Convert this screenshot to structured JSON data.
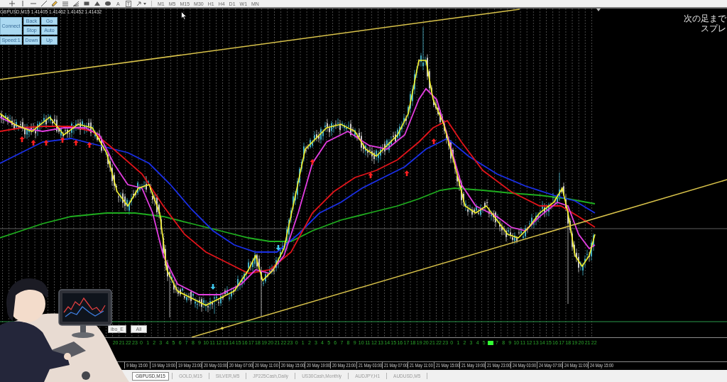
{
  "toolbar": {
    "glyph_tools": [
      {
        "label": "A",
        "kind": "plain"
      },
      {
        "label": "T",
        "kind": "boxed"
      }
    ],
    "timeframes": [
      "M1",
      "M5",
      "M15",
      "M30",
      "H1",
      "H4",
      "D1",
      "W1",
      "MN"
    ]
  },
  "chart": {
    "header": "GBPUSD,M15 1.41405 1.41462 1.41452 1.41432",
    "control_buttons": [
      {
        "label": "Connect",
        "kind": "tall"
      },
      {
        "label": "Back",
        "kind": "small"
      },
      {
        "label": "Go",
        "kind": "small"
      },
      {
        "label": "Stop",
        "kind": "small"
      },
      {
        "label": "Auto",
        "kind": "small"
      },
      {
        "label": "Speed:1",
        "kind": "small"
      },
      {
        "label": "Down",
        "kind": "small"
      },
      {
        "label": "Up",
        "kind": "small"
      }
    ],
    "info_lines": [
      "次の足まで",
      "スプレ"
    ],
    "object_buttons": [
      "ibo_E",
      "All"
    ]
  },
  "hour_labels": [
    {
      "kind": "hour",
      "text": "20"
    },
    {
      "kind": "hour",
      "text": "21"
    },
    {
      "kind": "hour",
      "text": "22"
    },
    {
      "kind": "hour",
      "text": "23"
    },
    {
      "kind": "hour",
      "text": "0"
    },
    {
      "kind": "hour",
      "text": "1"
    },
    {
      "kind": "hour",
      "text": "2"
    },
    {
      "kind": "hour",
      "text": "3"
    },
    {
      "kind": "hour",
      "text": "4"
    },
    {
      "kind": "hour",
      "text": "5"
    },
    {
      "kind": "hour",
      "text": "6"
    },
    {
      "kind": "hour",
      "text": "7"
    },
    {
      "kind": "hour",
      "text": "8"
    },
    {
      "kind": "hour",
      "text": "9"
    },
    {
      "kind": "hour",
      "text": "10"
    },
    {
      "kind": "hour",
      "text": "11"
    },
    {
      "kind": "hour",
      "text": "12"
    },
    {
      "kind": "hour",
      "text": "13"
    },
    {
      "kind": "hour",
      "text": "14"
    },
    {
      "kind": "hour",
      "text": "15"
    },
    {
      "kind": "hour",
      "text": "16"
    },
    {
      "kind": "hour",
      "text": "17"
    },
    {
      "kind": "hour",
      "text": "18"
    },
    {
      "kind": "hour",
      "text": "19"
    },
    {
      "kind": "hour",
      "text": "20"
    },
    {
      "kind": "hour",
      "text": "21"
    },
    {
      "kind": "hour",
      "text": "22"
    },
    {
      "kind": "hour",
      "text": "23"
    },
    {
      "kind": "hour",
      "text": "0"
    },
    {
      "kind": "hour",
      "text": "1"
    },
    {
      "kind": "hour",
      "text": "2"
    },
    {
      "kind": "hour",
      "text": "3"
    },
    {
      "kind": "hour",
      "text": "4"
    },
    {
      "kind": "hour",
      "text": "5"
    },
    {
      "kind": "hour",
      "text": "6"
    },
    {
      "kind": "hour",
      "text": "7"
    },
    {
      "kind": "hour",
      "text": "8"
    },
    {
      "kind": "hour",
      "text": "9"
    },
    {
      "kind": "hour",
      "text": "10"
    },
    {
      "kind": "hour",
      "text": "11"
    },
    {
      "kind": "hour",
      "text": "12"
    },
    {
      "kind": "hour",
      "text": "13"
    },
    {
      "kind": "hour",
      "text": "14"
    },
    {
      "kind": "hour",
      "text": "15"
    },
    {
      "kind": "hour",
      "text": "16"
    },
    {
      "kind": "hour",
      "text": "17"
    },
    {
      "kind": "hour",
      "text": "18"
    },
    {
      "kind": "hour",
      "text": "19"
    },
    {
      "kind": "hour",
      "text": "20"
    },
    {
      "kind": "hour",
      "text": "21"
    },
    {
      "kind": "hour",
      "text": "22"
    },
    {
      "kind": "hour",
      "text": "23"
    },
    {
      "kind": "hour",
      "text": "0"
    },
    {
      "kind": "hour",
      "text": "1"
    },
    {
      "kind": "hour",
      "text": "2"
    },
    {
      "kind": "hour",
      "text": "3"
    },
    {
      "kind": "hour",
      "text": "4"
    },
    {
      "kind": "hour",
      "text": "5"
    },
    {
      "kind": "marker"
    },
    {
      "kind": "hour",
      "text": "7"
    },
    {
      "kind": "hour",
      "text": "8"
    },
    {
      "kind": "hour",
      "text": "9"
    },
    {
      "kind": "hour",
      "text": "10"
    },
    {
      "kind": "hour",
      "text": "11"
    },
    {
      "kind": "hour",
      "text": "12"
    },
    {
      "kind": "hour",
      "text": "13"
    },
    {
      "kind": "hour",
      "text": "14"
    },
    {
      "kind": "hour",
      "text": "15"
    },
    {
      "kind": "hour",
      "text": "16"
    },
    {
      "kind": "hour",
      "text": "17"
    },
    {
      "kind": "hour",
      "text": "18"
    },
    {
      "kind": "hour",
      "text": "19"
    },
    {
      "kind": "hour",
      "text": "20"
    },
    {
      "kind": "hour",
      "text": "21"
    },
    {
      "kind": "hour",
      "text": "22"
    }
  ],
  "time_axis": [
    "9 May 15:00",
    "19 May 19:00",
    "19 May 23:00",
    "20 May 03:00",
    "20 May 07:00",
    "20 May 11:00",
    "20 May 15:00",
    "20 May 19:00",
    "20 May 23:00",
    "21 May 03:00",
    "21 May 07:00",
    "21 May 11:00",
    "21 May 15:00",
    "21 May 19:00",
    "21 May 23:00",
    "24 May 03:00",
    "24 May 07:00",
    "24 May 11:00",
    "24 May 15:00"
  ],
  "tabs": [
    {
      "label": "GBPUSD,M15",
      "selected": true
    },
    {
      "label": "GOLD,M15",
      "selected": false
    },
    {
      "label": "SILVER,M5",
      "selected": false
    },
    {
      "label": "JP225Cash,Daily",
      "selected": false
    },
    {
      "label": "US30Cash,Monthly",
      "selected": false
    },
    {
      "label": "AUDJPY,H1",
      "selected": false
    },
    {
      "label": "AUDUSD,M5",
      "selected": false
    }
  ]
}
